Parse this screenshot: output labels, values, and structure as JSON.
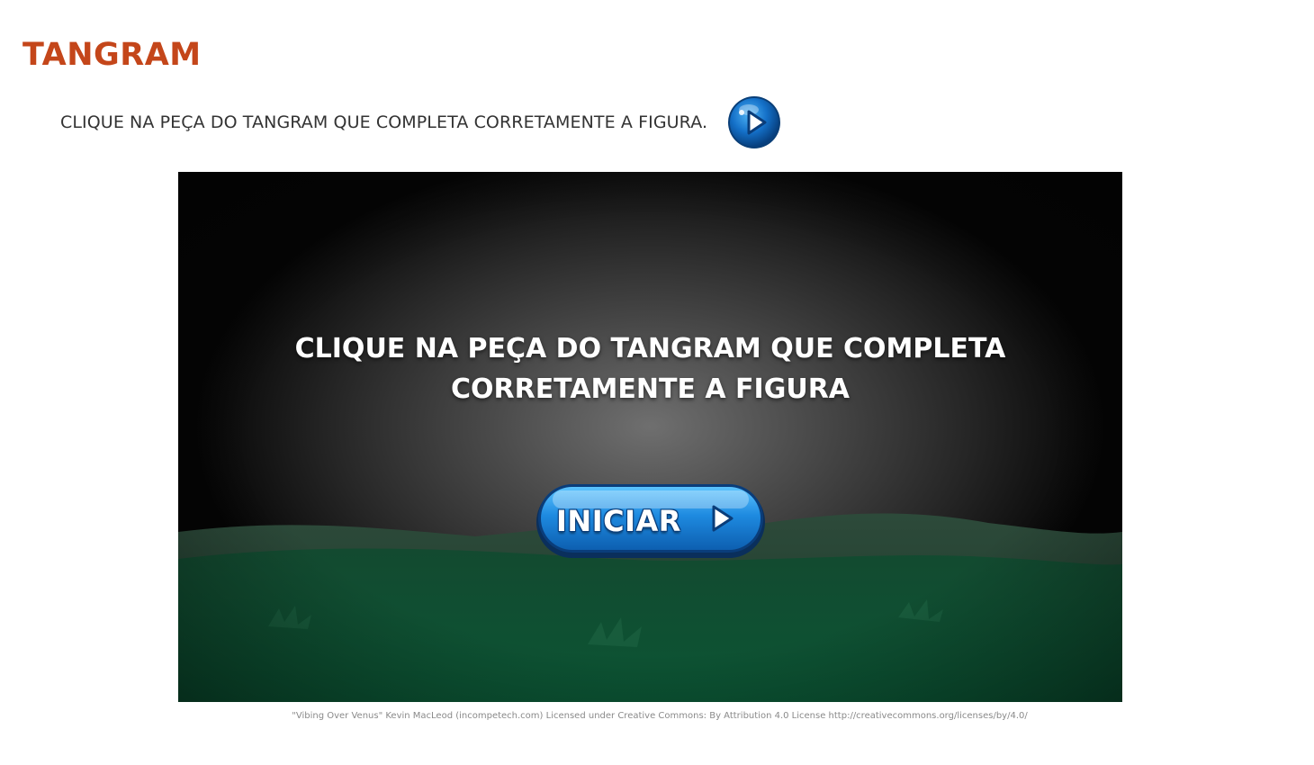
{
  "header": {
    "title": "TANGRAM",
    "instruction": "CLIQUE NA PEÇA DO TANGRAM QUE COMPLETA CORRETAMENTE A FIGURA.",
    "audio_button_icon": "play-icon"
  },
  "game": {
    "prompt_line1": "CLIQUE NA PEÇA DO TANGRAM QUE COMPLETA",
    "prompt_line2": "CORRETAMENTE A FIGURA",
    "start_button_label": "INICIAR",
    "start_button_icon": "play-triangle-icon"
  },
  "footer": {
    "credits": "\"Vibing Over Venus\" Kevin MacLeod (incompetech.com) Licensed under Creative Commons: By Attribution 4.0 License http://creativecommons.org/licenses/by/4.0/"
  },
  "colors": {
    "title": "#c4461a",
    "button_blue": "#1a7fd6",
    "grass_green": "#0e5a36"
  }
}
